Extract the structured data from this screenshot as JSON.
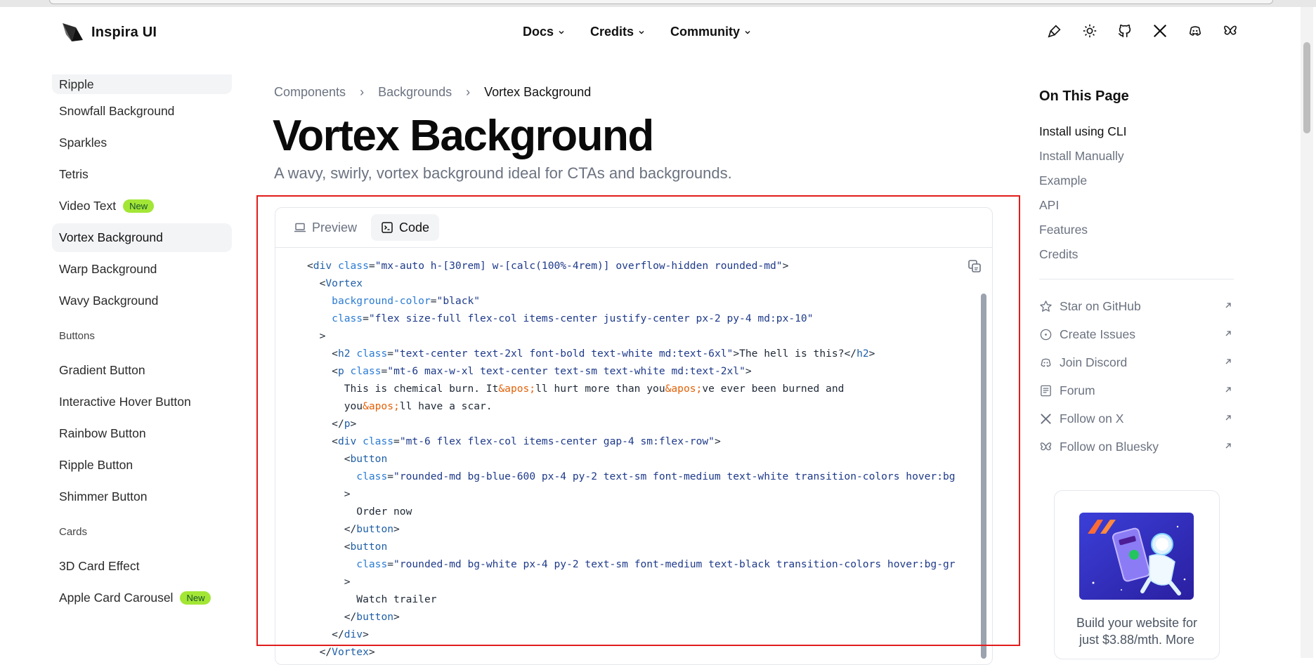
{
  "app": {
    "name": "Inspira UI"
  },
  "nav": [
    {
      "label": "Docs"
    },
    {
      "label": "Credits"
    },
    {
      "label": "Community"
    }
  ],
  "header_icons": [
    "brush-icon",
    "sun-icon",
    "github-icon",
    "x-icon",
    "discord-icon",
    "bluesky-icon"
  ],
  "sidebar": {
    "items_top": [
      {
        "label": "Ripple"
      },
      {
        "label": "Snowfall Background"
      },
      {
        "label": "Sparkles"
      },
      {
        "label": "Tetris"
      },
      {
        "label": "Video Text",
        "badge": "New"
      },
      {
        "label": "Vortex Background",
        "active": true
      },
      {
        "label": "Warp Background"
      },
      {
        "label": "Wavy Background"
      }
    ],
    "buttons_heading": "Buttons",
    "buttons": [
      {
        "label": "Gradient Button"
      },
      {
        "label": "Interactive Hover Button"
      },
      {
        "label": "Rainbow Button"
      },
      {
        "label": "Ripple Button"
      },
      {
        "label": "Shimmer Button"
      }
    ],
    "cards_heading": "Cards",
    "cards": [
      {
        "label": "3D Card Effect"
      },
      {
        "label": "Apple Card Carousel",
        "badge": "New"
      }
    ]
  },
  "breadcrumb": {
    "items": [
      "Components",
      "Backgrounds",
      "Vortex Background"
    ],
    "separator": "›"
  },
  "page": {
    "title": "Vortex Background",
    "subtitle": "A wavy, swirly, vortex background ideal for CTAs and backgrounds."
  },
  "tabs": [
    {
      "label": "Preview"
    },
    {
      "label": "Code",
      "active": true
    }
  ],
  "code": {
    "l1_tag": "div",
    "l1_attr": "class",
    "l1_val": "\"mx-auto h-[30rem] w-[calc(100%-4rem)] overflow-hidden rounded-md\"",
    "l2_tag": "Vortex",
    "l3_attr": "background-color",
    "l3_val": "\"black\"",
    "l4_attr": "class",
    "l4_val": "\"flex size-full flex-col items-center justify-center px-2 py-4 md:px-10\"",
    "l6_tag": "h2",
    "l6_attr": "class",
    "l6_val": "\"text-center text-2xl font-bold text-white md:text-6xl\"",
    "l6_text": "The hell is this?",
    "l7_tag": "p",
    "l7_attr": "class",
    "l7_val": "\"mt-6 max-w-xl text-center text-sm text-white md:text-2xl\"",
    "l8_a": "This is chemical burn. It",
    "l8_e1": "&apos;",
    "l8_b": "ll hurt more than you",
    "l8_e2": "&apos;",
    "l8_c": "ve ever been burned and",
    "l9_a": "you",
    "l9_e": "&apos;",
    "l9_b": "ll have a scar.",
    "l10_tag": "p",
    "l11_tag": "div",
    "l11_attr": "class",
    "l11_val": "\"mt-6 flex flex-col items-center gap-4 sm:flex-row\"",
    "l12_tag": "button",
    "l13_attr": "class",
    "l13_val": "\"rounded-md bg-blue-600 px-4 py-2 text-sm font-medium text-white transition-colors hover:bg",
    "l15_text": "Order now",
    "l16_tag": "button",
    "l17_tag": "button",
    "l18_attr": "class",
    "l18_val": "\"rounded-md bg-white px-4 py-2 text-sm font-medium text-black transition-colors hover:bg-gr",
    "l20_text": "Watch trailer",
    "l21_tag": "button",
    "l22_tag": "div",
    "l23_tag": "Vortex"
  },
  "toc": {
    "title": "On This Page",
    "items": [
      {
        "label": "Install using CLI",
        "active": true
      },
      {
        "label": "Install Manually"
      },
      {
        "label": "Example"
      },
      {
        "label": "API"
      },
      {
        "label": "Features"
      },
      {
        "label": "Credits"
      }
    ]
  },
  "community_links": [
    {
      "label": "Star on GitHub",
      "icon": "star-icon"
    },
    {
      "label": "Create Issues",
      "icon": "issue-icon"
    },
    {
      "label": "Join Discord",
      "icon": "discord-icon"
    },
    {
      "label": "Forum",
      "icon": "forum-icon"
    },
    {
      "label": "Follow on X",
      "icon": "x-icon"
    },
    {
      "label": "Follow on Bluesky",
      "icon": "bluesky-icon"
    }
  ],
  "ad": {
    "text_line1": "Build your website for",
    "text_line2": "just $3.88/mth. More"
  },
  "colors": {
    "accent_badge": "#a3e635",
    "highlight": "#e11d1d",
    "code_tag": "#1f5fa8",
    "code_entity": "#e36209"
  }
}
